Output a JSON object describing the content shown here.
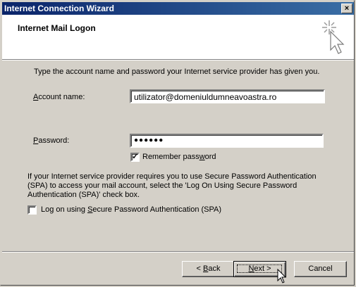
{
  "window": {
    "title": "Internet Connection Wizard",
    "close_label": "×"
  },
  "header": {
    "title": "Internet Mail Logon",
    "icon": "wizard-sparkle-cursor-icon"
  },
  "instructions": "Type the account name and password your Internet service provider has given you.",
  "account": {
    "label_prefix": "",
    "label_mnemonic": "A",
    "label_rest": "ccount name:",
    "value": "utilizator@domeniuldumneavoastra.ro"
  },
  "password": {
    "label_mnemonic": "P",
    "label_rest": "assword:",
    "value": "●●●●●●"
  },
  "remember": {
    "checked": true,
    "check_mark": "✓",
    "label_prefix": "Remember pass",
    "label_mnemonic": "w",
    "label_rest": "ord"
  },
  "spa_note": "If your Internet service provider requires you to use Secure Password Authentication (SPA) to access your mail account, select the 'Log On Using Secure Password Authentication (SPA)' check box.",
  "spa": {
    "checked": false,
    "label_prefix": "Log on using ",
    "label_mnemonic": "S",
    "label_rest": "ecure Password Authentication (SPA)"
  },
  "buttons": {
    "back_prefix": "< ",
    "back_mnemonic": "B",
    "back_rest": "ack",
    "next_prefix": "",
    "next_mnemonic": "N",
    "next_rest": "ext >",
    "cancel": "Cancel"
  }
}
